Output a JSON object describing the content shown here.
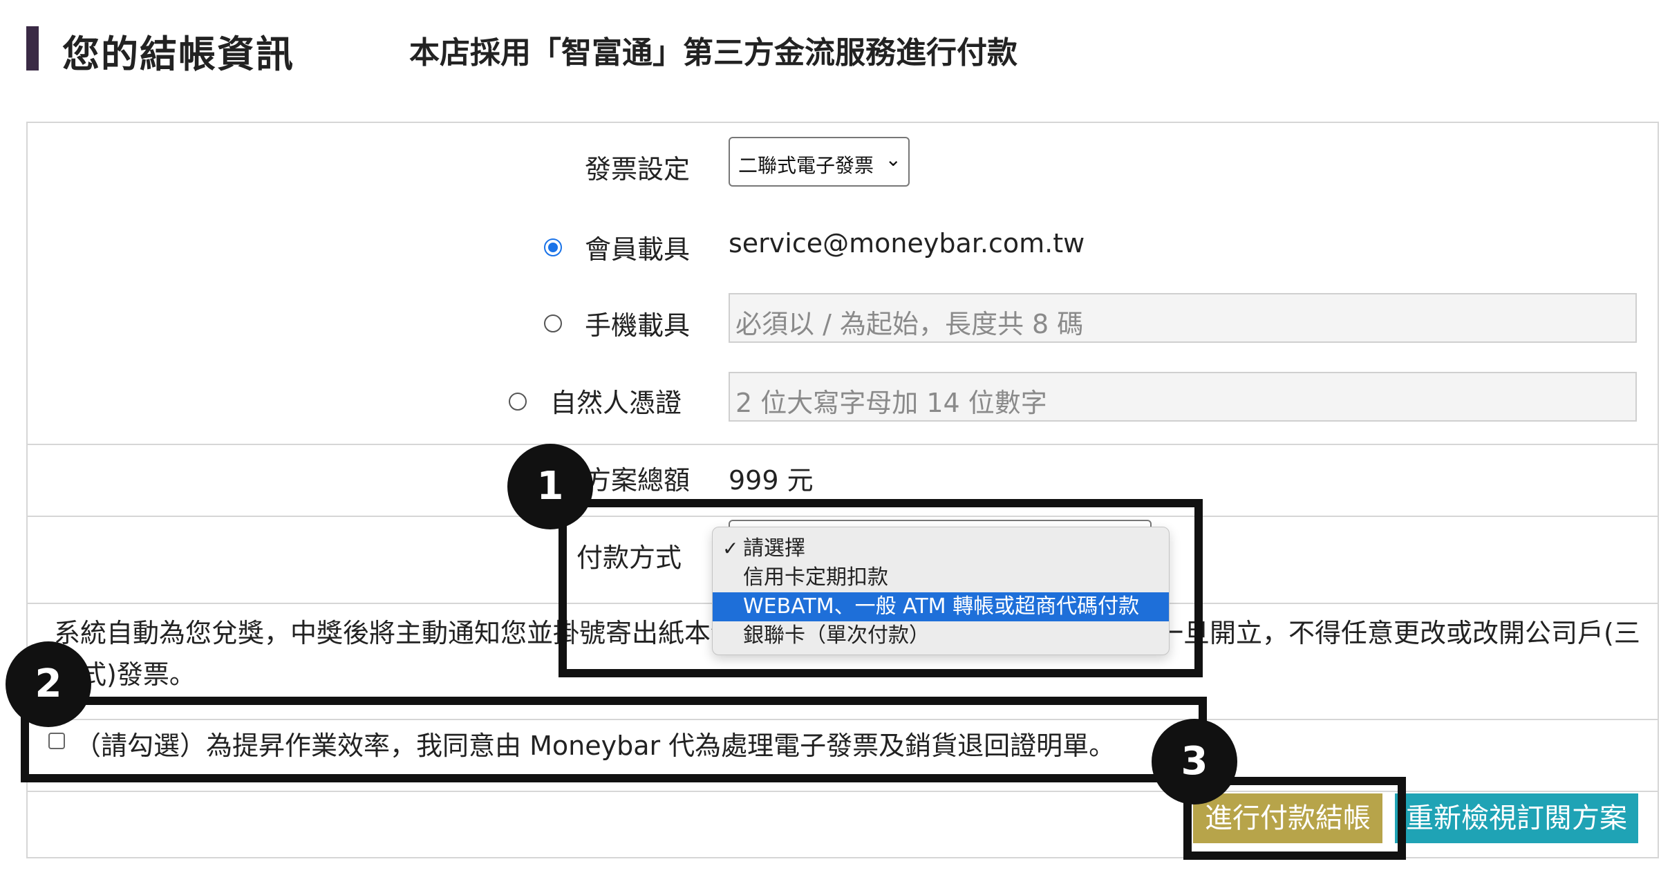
{
  "header": {
    "title": "您的結帳資訊",
    "subtitle": "本店採用「智富通」第三方金流服務進行付款"
  },
  "invoice": {
    "label": "發票設定",
    "selected": "二聯式電子發票"
  },
  "carriers": [
    {
      "label": "會員載具",
      "checked": true,
      "value": "service@moneybar.com.tw"
    },
    {
      "label": "手機載具",
      "checked": false,
      "placeholder": "必須以 / 為起始，長度共 8 碼"
    },
    {
      "label": "自然人憑證",
      "checked": false,
      "placeholder": "2 位大寫字母加 14 位數字"
    }
  ],
  "total": {
    "label": "方案總額",
    "value": "999 元"
  },
  "payment": {
    "label": "付款方式",
    "options": [
      {
        "label": "請選擇",
        "checked": true
      },
      {
        "label": "信用卡定期扣款"
      },
      {
        "label": "WEBATM、一般 ATM 轉帳或超商代碼付款",
        "highlighted": true
      },
      {
        "label": "銀聯卡（單次付款）"
      }
    ]
  },
  "notice": {
    "text": "系統自動為您兌獎，中獎後將主動通知您並掛號寄出紙本發票。依統一發票使用辦法規定：發票一旦開立，不得任意更改或改開公司戶(三聯式)發票。"
  },
  "agreement": {
    "text": "（請勾選）為提昇作業效率，我同意由 Moneybar 代為處理電子發票及銷貨退回證明單。"
  },
  "buttons": {
    "pay": "進行付款結帳",
    "review": "重新檢視訂閱方案"
  },
  "annotations": [
    "1",
    "2",
    "3"
  ],
  "colors": {
    "pay_button": "#b7a44a",
    "review_button": "#1fa3b5",
    "title_bar": "#3a2a45",
    "highlight": "#1e6fd9"
  }
}
